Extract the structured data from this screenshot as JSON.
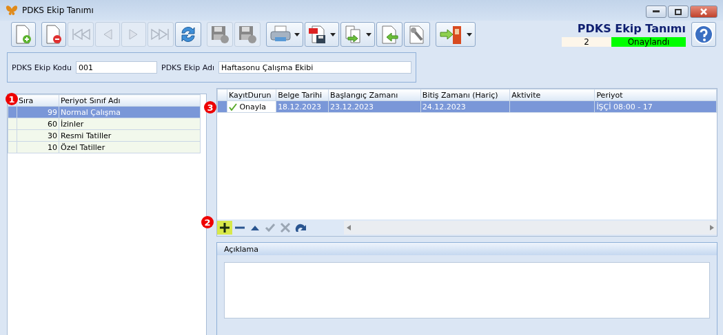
{
  "window": {
    "title": "PDKS Ekip Tanımı"
  },
  "toolbar": [
    {
      "kind": "new",
      "disabled": false,
      "dropdown": false
    },
    {
      "kind": "delete",
      "disabled": false,
      "dropdown": false
    },
    {
      "kind": "first",
      "disabled": true,
      "dropdown": false
    },
    {
      "kind": "prev",
      "disabled": true,
      "dropdown": false
    },
    {
      "kind": "next",
      "disabled": true,
      "dropdown": false
    },
    {
      "kind": "last",
      "disabled": true,
      "dropdown": false
    },
    {
      "kind": "refresh",
      "disabled": false,
      "dropdown": false
    },
    {
      "kind": "save",
      "disabled": true,
      "dropdown": false
    },
    {
      "kind": "cancel",
      "disabled": true,
      "dropdown": false
    },
    {
      "kind": "print",
      "disabled": false,
      "dropdown": true
    },
    {
      "kind": "pdf",
      "disabled": false,
      "dropdown": true
    },
    {
      "kind": "export",
      "disabled": false,
      "dropdown": true
    },
    {
      "kind": "import",
      "disabled": false,
      "dropdown": false
    },
    {
      "kind": "tools",
      "disabled": false,
      "dropdown": false
    },
    {
      "kind": "exit",
      "disabled": false,
      "dropdown": true
    }
  ],
  "header": {
    "title": "PDKS Ekip Tanımı",
    "count": "2",
    "status": "Onaylandı"
  },
  "form": {
    "fields": [
      {
        "label": "PDKS Ekip Kodu",
        "value": "001"
      },
      {
        "label": "PDKS Ekip Adı",
        "value": "Haftasonu Çalışma Ekibi"
      }
    ]
  },
  "left_grid": {
    "columns": [
      "Sıra",
      "Periyot Sınıf Adı"
    ],
    "rows": [
      {
        "order": "99",
        "name": "Normal Çalışma",
        "selected": true
      },
      {
        "order": "60",
        "name": "İzinler",
        "selected": false
      },
      {
        "order": "30",
        "name": "Resmi Tatiller",
        "selected": false
      },
      {
        "order": "10",
        "name": "Özel Tatiller",
        "selected": false
      }
    ]
  },
  "right_grid": {
    "columns": [
      "KayıtDurun",
      "Belge Tarihi",
      "Başlangıç Zamanı",
      "Bitiş Zamanı (Hariç)",
      "Aktivite",
      "Periyot"
    ],
    "rows": [
      {
        "approved": true,
        "selected": true,
        "cells": [
          "Onayla",
          "18.12.2023",
          "23.12.2023",
          "24.12.2023",
          "",
          "İŞÇİ 08:00 - 17"
        ]
      }
    ]
  },
  "nav_bar": [
    {
      "kind": "add",
      "highlighted": true,
      "disabled": false
    },
    {
      "kind": "remove",
      "highlighted": false,
      "disabled": false
    },
    {
      "kind": "up",
      "highlighted": false,
      "disabled": false
    },
    {
      "kind": "confirm",
      "highlighted": false,
      "disabled": true
    },
    {
      "kind": "discard",
      "highlighted": false,
      "disabled": true
    },
    {
      "kind": "redo",
      "highlighted": false,
      "disabled": false
    }
  ],
  "description": {
    "title": "Açıklama"
  },
  "badges": [
    "1",
    "2",
    "3"
  ]
}
